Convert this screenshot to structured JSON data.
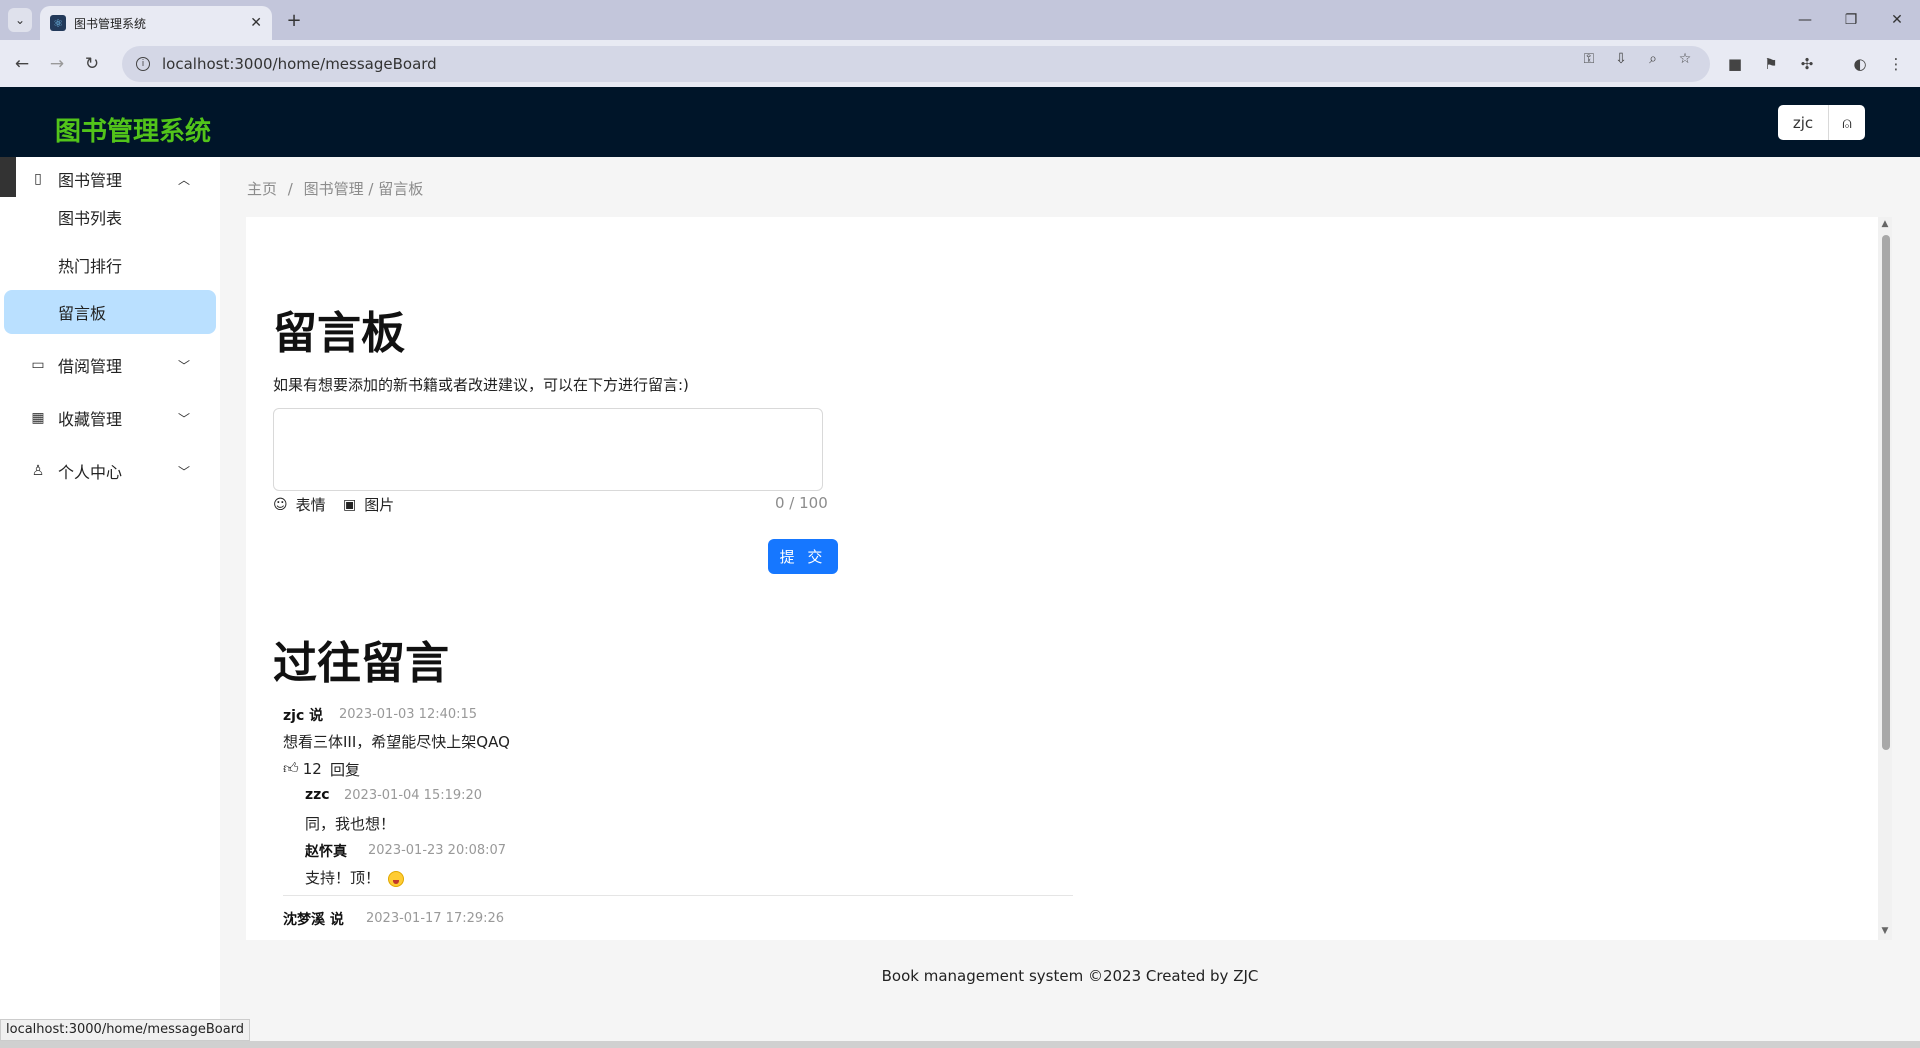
{
  "browser": {
    "tab_title": "图书管理系统",
    "url": "localhost:3000/home/messageBoard",
    "status_url": "localhost:3000/home/messageBoard"
  },
  "header": {
    "logo": "图书管理系统",
    "username": "zjc"
  },
  "sidebar": {
    "groups": [
      {
        "label": "图书管理",
        "icon": "book-icon",
        "expanded": true,
        "items": [
          {
            "label": "图书列表"
          },
          {
            "label": "热门排行"
          },
          {
            "label": "留言板",
            "active": true
          }
        ]
      },
      {
        "label": "借阅管理",
        "icon": "laptop-icon",
        "expanded": false
      },
      {
        "label": "收藏管理",
        "icon": "grid-icon",
        "expanded": false
      },
      {
        "label": "个人中心",
        "icon": "user-icon",
        "expanded": false
      }
    ]
  },
  "breadcrumb": {
    "home": "主页",
    "sep": "/",
    "path": "图书管理 / 留言板"
  },
  "board": {
    "title": "留言板",
    "intro": "如果有想要添加的新书籍或者改进建议，可以在下方进行留言:)",
    "emoji_label": "表情",
    "image_label": "图片",
    "counter": "0 / 100",
    "submit_label": "提 交",
    "past_title": "过往留言"
  },
  "comments": [
    {
      "author": "zjc 说",
      "time": "2023-01-03 12:40:15",
      "text": "想看三体III，希望能尽快上架QAQ",
      "likes": "12",
      "reply_label": "回复",
      "replies": [
        {
          "author": "zzc",
          "time": "2023-01-04 15:19:20",
          "text": "同，我也想！"
        },
        {
          "author": "赵怀真",
          "time": "2023-01-23 20:08:07",
          "text": "支持！顶！"
        }
      ]
    },
    {
      "author": "沈梦溪 说",
      "time": "2023-01-17 17:29:26"
    }
  ],
  "footer": {
    "text": "Book management system ©2023 Created by ZJC"
  },
  "colors": {
    "header_bg": "#001529",
    "logo": "#52c41a",
    "primary": "#1677ff",
    "active_menu": "#bae0ff"
  }
}
